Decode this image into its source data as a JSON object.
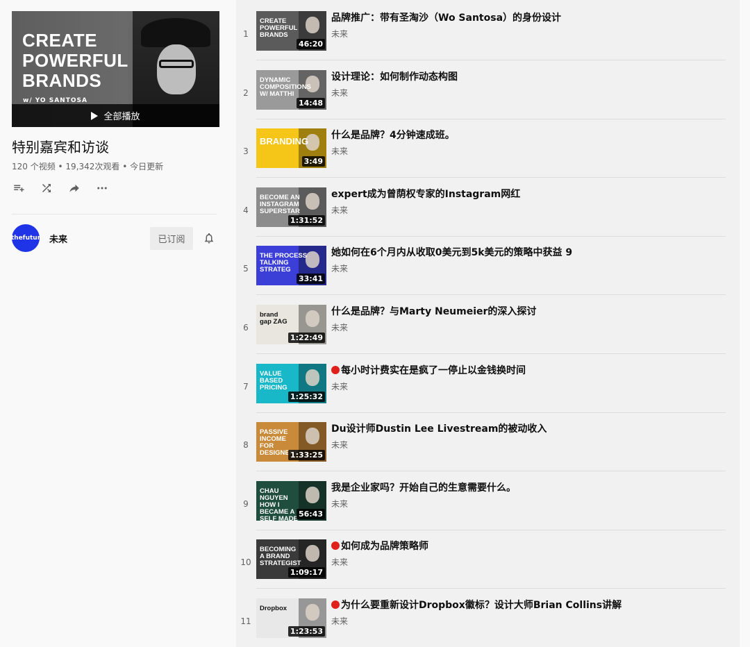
{
  "playlist": {
    "hero_title": "CREATE\nPOWERFUL\nBRANDS",
    "hero_subtitle": "w/ YO SANTOSA",
    "play_all_label": "全部播放",
    "title": "特别嘉宾和访谈",
    "stats": "120 个视频 • 19,342次观看 • 今日更新",
    "actions": [
      "add-to-queue-icon",
      "shuffle-icon",
      "share-icon",
      "more-icon"
    ]
  },
  "owner": {
    "avatar_text": "thefutur",
    "name": "未来",
    "subscribe_label": "已订阅"
  },
  "colors": {
    "avatar_bg": "#1f34e6",
    "live_dot": "#e0201b"
  },
  "videos": [
    {
      "index": "1",
      "title": "品牌推广：带有圣淘沙（Wo Santosa）的身份设计",
      "channel": "未来",
      "duration": "46:20",
      "thumb_text": "CREATE\nPOWERFUL\nBRANDS",
      "thumb_bg": "#5b5b5b",
      "red_dot": false
    },
    {
      "index": "2",
      "title": "设计理论：如何制作动态构图",
      "channel": "未来",
      "duration": "14:48",
      "thumb_text": "DYNAMIC\nCOMPOSITIONS\nW/ MATTHI",
      "thumb_bg": "#9a9a9a",
      "red_dot": false
    },
    {
      "index": "3",
      "title": "什么是品牌？4分钟速成班。",
      "channel": "未来",
      "duration": "3:49",
      "thumb_text": "BRANDING",
      "thumb_bg": "#f5c518",
      "red_dot": false
    },
    {
      "index": "4",
      "title": "expert成为曾荫权专家的Instagram网红",
      "channel": "未来",
      "duration": "1:31:52",
      "thumb_text": "BECOME AN\nINSTAGRAM\nSUPERSTAR",
      "thumb_bg": "#8c8c8c",
      "red_dot": false
    },
    {
      "index": "5",
      "title": "她如何在6个月内从收取0美元到5k美元的策略中获益 9",
      "channel": "未来",
      "duration": "33:41",
      "thumb_text": "THE PROCESS\nTALKING\nSTRATEG",
      "thumb_bg": "#3b3fd8",
      "red_dot": false
    },
    {
      "index": "6",
      "title": "什么是品牌？与Marty Neumeier的深入探讨",
      "channel": "未来",
      "duration": "1:22:49",
      "thumb_text": "brand\ngap  ZAG",
      "thumb_bg": "#e9e6df",
      "red_dot": false
    },
    {
      "index": "7",
      "title": "每小时计费实在是疯了一停止以金钱换时间",
      "channel": "未来",
      "duration": "1:25:32",
      "thumb_text": "VALUE\nBASED\nPRICING",
      "thumb_bg": "#19b8c9",
      "red_dot": true
    },
    {
      "index": "8",
      "title": "Du设计师Dustin Lee Livestream的被动收入",
      "channel": "未来",
      "duration": "1:33:25",
      "thumb_text": "PASSIVE\nINCOME\nFOR\nDESIGNERS",
      "thumb_bg": "#c98a3a",
      "red_dot": false
    },
    {
      "index": "9",
      "title": "我是企业家吗？开始自己的生意需要什么。",
      "channel": "未来",
      "duration": "56:43",
      "thumb_text": "CHAU NGUYEN\nHOW I BECAME A\nSELF MADE\nMILLIONAI",
      "thumb_bg": "#1f4d3e",
      "red_dot": false
    },
    {
      "index": "10",
      "title": "如何成为品牌策略师",
      "channel": "未来",
      "duration": "1:09:17",
      "thumb_text": "BECOMING\nA BRAND\nSTRATEGIST",
      "thumb_bg": "#3a3a3a",
      "red_dot": true
    },
    {
      "index": "11",
      "title": "为什么要重新设计Dropbox徽标？设计大师Brian Collins讲解",
      "channel": "未来",
      "duration": "1:23:53",
      "thumb_text": "Dropbox",
      "thumb_bg": "#e8e8e8",
      "red_dot": true
    }
  ]
}
